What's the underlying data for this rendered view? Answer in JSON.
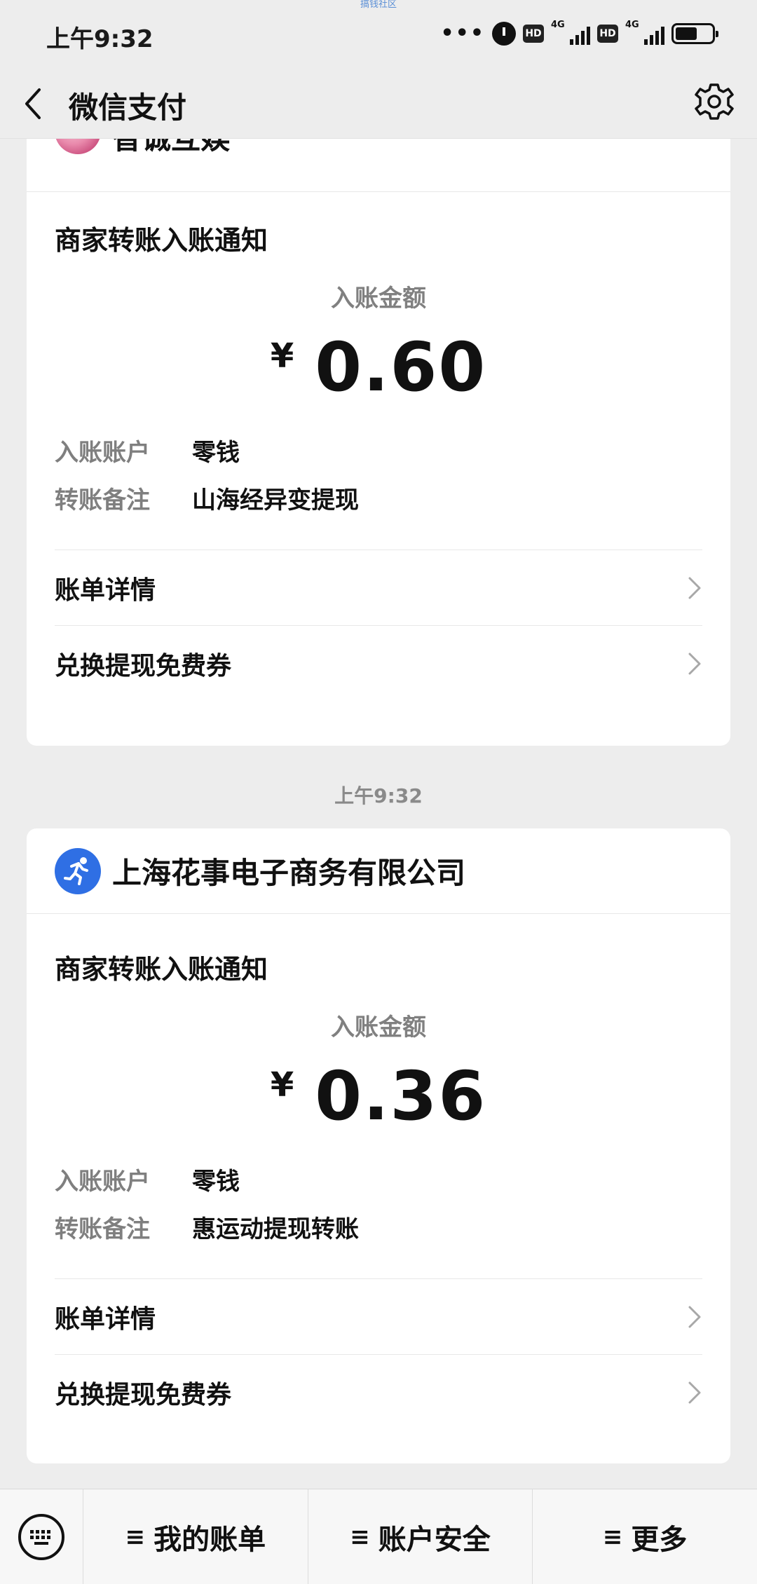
{
  "watermark": "搞钱社区",
  "status_bar": {
    "time": "上午9:32",
    "icons": [
      "more-dots-icon",
      "alarm-icon",
      "hd-icon",
      "signal-4g-icon",
      "hd-icon",
      "signal-4g-icon",
      "battery-icon"
    ],
    "network_1": "4G",
    "network_2": "4G",
    "hd_label": "HD"
  },
  "nav": {
    "title": "微信支付",
    "back_icon": "chevron-left-icon",
    "settings_icon": "gear-icon"
  },
  "messages": [
    {
      "merchant": "智诚互娱",
      "notice_title": "商家转账入账通知",
      "amount_label": "入账金额",
      "currency": "¥",
      "amount": "0.60",
      "account_key": "入账账户",
      "account_val": "零钱",
      "remark_key": "转账备注",
      "remark_val": "山海经异变提现",
      "link_1": "账单详情",
      "link_2": "兑换提现免费券"
    },
    {
      "timestamp": "上午9:32",
      "merchant": "上海花事电子商务有限公司",
      "notice_title": "商家转账入账通知",
      "amount_label": "入账金额",
      "currency": "¥",
      "amount": "0.36",
      "account_key": "入账账户",
      "account_val": "零钱",
      "remark_key": "转账备注",
      "remark_val": "惠运动提现转账",
      "link_1": "账单详情",
      "link_2": "兑换提现免费券"
    }
  ],
  "bottom_menu": {
    "keyboard_icon": "keyboard-icon",
    "items": [
      {
        "icon": "≡",
        "label": "我的账单"
      },
      {
        "icon": "≡",
        "label": "账户安全"
      },
      {
        "icon": "≡",
        "label": "更多"
      }
    ]
  },
  "colors": {
    "background": "#ededed",
    "card": "#ffffff",
    "muted_text": "#808080",
    "runner_avatar": "#2f6fe4"
  }
}
